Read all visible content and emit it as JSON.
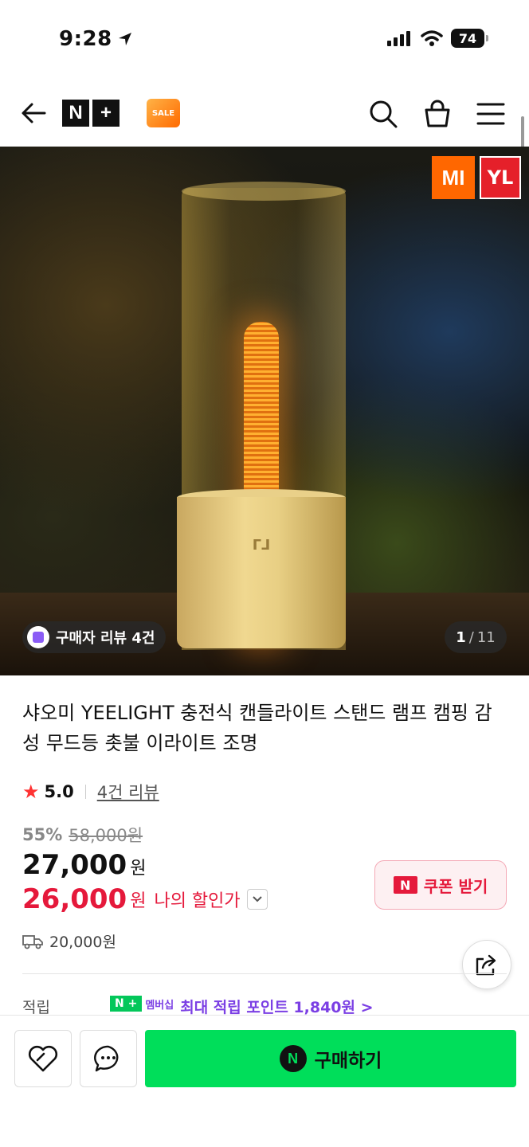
{
  "status": {
    "time": "9:28",
    "battery": "74"
  },
  "nav": {
    "logo_left": "N",
    "logo_right": "+",
    "badge_text": "SALE"
  },
  "hero": {
    "brand_mi": "MI",
    "brand_yeelight": "YL",
    "review_chip": "구매자 리뷰 4건",
    "counter_current": "1",
    "counter_sep": "/",
    "counter_total": "11"
  },
  "product": {
    "title": "샤오미 YEELIGHT 충전식 캔들라이트 스탠드 램프 캠핑 감성 무드등 촛불 이라이트 조명",
    "rating": "5.0",
    "review_link": "4건 리뷰",
    "discount_pct": "55%",
    "original_price": "58,000원",
    "price": "27,000",
    "price_unit": "원",
    "my_price": "26,000",
    "my_price_unit": "원",
    "my_price_label": "나의 할인가",
    "shipping": "20,000원",
    "coupon_label": "쿠폰 받기"
  },
  "points": {
    "label": "적립",
    "membership_tag": "N +",
    "membership_text": "멤버십",
    "max_points": "최대 적립 포인트 1,840원 >"
  },
  "bottom": {
    "buy_label": "구매하기"
  },
  "colors": {
    "accent_green": "#00de5a",
    "price_red": "#e5193b",
    "membership_purple": "#7b3fe4"
  }
}
